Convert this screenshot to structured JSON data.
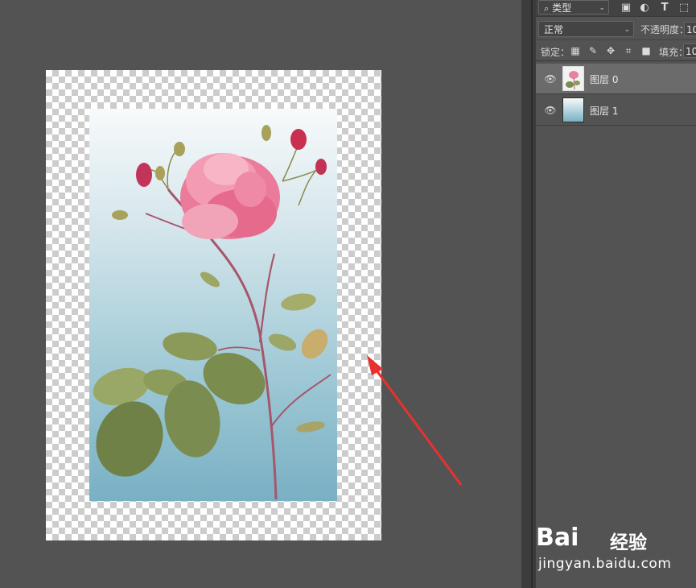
{
  "layers_panel": {
    "filter": {
      "icon": "search-icon",
      "label": "类型"
    },
    "filter_icons": [
      "image-filter-icon",
      "adjustment-filter-icon",
      "type-filter-icon",
      "shape-filter-icon"
    ],
    "filter_glyphs": {
      "image": "▣",
      "adjustment": "◐",
      "type": "T",
      "shape": "⬚"
    },
    "blend_mode": "正常",
    "opacity_label": "不透明度：",
    "opacity_value": "10",
    "lock_label": "锁定：",
    "lock_icons": [
      "lock-transparent-pixels-icon",
      "lock-image-pixels-icon",
      "lock-position-icon",
      "lock-artboard-icon",
      "lock-all-icon"
    ],
    "fill_label": "填充：",
    "fill_value": "10",
    "layers": [
      {
        "name": "图层 0",
        "visible": true,
        "selected": true,
        "thumb": "rose"
      },
      {
        "name": "图层 1",
        "visible": true,
        "selected": false,
        "thumb": "gradient"
      }
    ]
  },
  "colors": {
    "ui_background": "#535353",
    "selected_layer": "#6b6b6b",
    "arrow": "#e8312f",
    "gradient_top": "#f7fafb",
    "gradient_bottom": "#79b0c4"
  },
  "watermark": {
    "logo": "Bai",
    "logo_cn": "经验",
    "url": "jingyan.baidu.com"
  }
}
